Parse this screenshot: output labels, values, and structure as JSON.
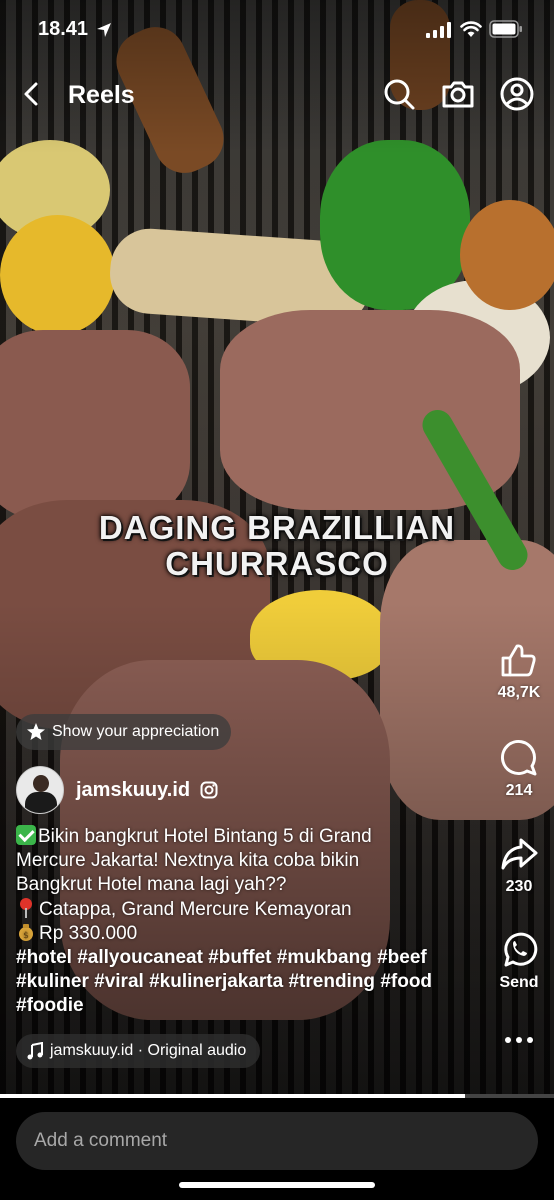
{
  "status_bar": {
    "time": "18.41"
  },
  "header": {
    "title": "Reels"
  },
  "reel": {
    "overlay_title_line1": "DAGING BRAZILLIAN",
    "overlay_title_line2": "CHURRASCO",
    "progress": 0.84
  },
  "actions": {
    "like_count": "48,7K",
    "comment_count": "214",
    "share_count": "230",
    "send_label": "Send"
  },
  "appreciation": {
    "label": "Show your appreciation"
  },
  "author": {
    "username": "jamskuuy.id"
  },
  "caption": {
    "line1": "Bikin bangkrut Hotel Bintang 5 di Grand",
    "line2": "Mercure Jakarta! Nextnya kita coba bikin",
    "line3": "Bangkrut Hotel mana lagi yah??",
    "location": "Catappa, Grand Mercure Kemayoran",
    "price": "Rp 330.000",
    "tags1": "#hotel #allyoucaneat #buffet #mukbang #beef",
    "tags2": "#kuliner #viral #kulinerjakarta #trending #food",
    "tags3": "#foodie"
  },
  "audio": {
    "label": "jamskuuy.id · Original audio"
  },
  "comment_bar": {
    "placeholder": "Add a comment"
  },
  "icons": {
    "back": "chevron-left-icon",
    "search": "search-icon",
    "camera": "camera-icon",
    "profile": "profile-icon",
    "like": "thumbs-up-icon",
    "comment": "comment-bubble-icon",
    "share": "share-arrow-icon",
    "send": "whatsapp-icon",
    "more": "more-horizontal-icon",
    "audio": "music-note-icon"
  }
}
